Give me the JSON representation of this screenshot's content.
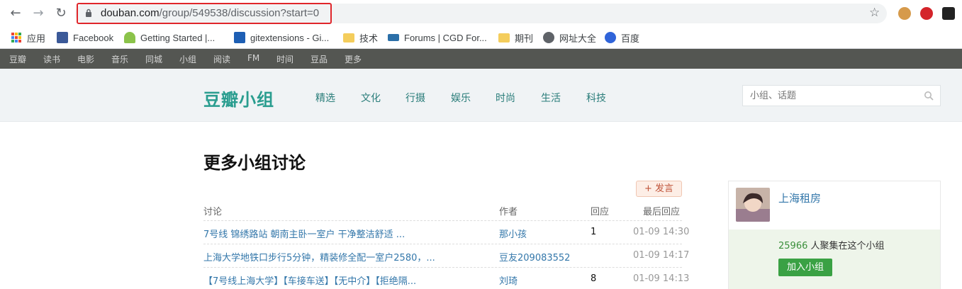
{
  "browser": {
    "url_host": "douban.com",
    "url_path": "/group/549538/discussion?start=0",
    "bookmarks": [
      {
        "label": "应用",
        "icon": "apps-grid-icon"
      },
      {
        "label": "Facebook",
        "icon": "facebook-icon"
      },
      {
        "label": "Getting Started |...",
        "icon": "android-icon"
      },
      {
        "label": "gitextensions - Gi...",
        "icon": "gitextensions-icon"
      },
      {
        "label": "技术",
        "icon": "folder-icon"
      },
      {
        "label": "Forums | CGD For...",
        "icon": "forum-icon"
      },
      {
        "label": "期刊",
        "icon": "folder-icon"
      },
      {
        "label": "网址大全",
        "icon": "globe-icon"
      },
      {
        "label": "百度",
        "icon": "baidu-paw-icon"
      }
    ]
  },
  "global_nav": [
    "豆瓣",
    "读书",
    "电影",
    "音乐",
    "同城",
    "小组",
    "阅读",
    "FM",
    "时间",
    "豆品",
    "更多"
  ],
  "header": {
    "logo": "豆瓣小组",
    "categories": [
      "精选",
      "文化",
      "行摄",
      "娱乐",
      "时尚",
      "生活",
      "科技"
    ],
    "search_placeholder": "小组、话题"
  },
  "main": {
    "title": "更多小组讨论",
    "post_button": "+ 发言",
    "columns": {
      "topic": "讨论",
      "author": "作者",
      "replies": "回应",
      "last_reply": "最后回应"
    },
    "rows": [
      {
        "topic": "7号线 锦绣路站 朝南主卧一室户 干净整洁舒适 ...",
        "author": "那小孩",
        "replies": "1",
        "last_reply": "01-09 14:30"
      },
      {
        "topic": "上海大学地铁口步行5分钟，精装修全配一室户2580，...",
        "author": "豆友209083552",
        "replies": "",
        "last_reply": "01-09 14:17"
      },
      {
        "topic": "【7号线上海大学】【车接车送】【无中介】【拒绝隔...",
        "author": "刘琦",
        "replies": "8",
        "last_reply": "01-09 14:13"
      }
    ]
  },
  "sidebar": {
    "group_name": "上海租房",
    "member_count": "25966",
    "member_suffix": " 人聚集在这个小组",
    "join_button": "加入小组"
  },
  "colors": {
    "accent_green": "#3aa144",
    "link_blue": "#3377aa",
    "logo_teal": "#2a9d8f",
    "highlight_red": "#e0262b"
  }
}
